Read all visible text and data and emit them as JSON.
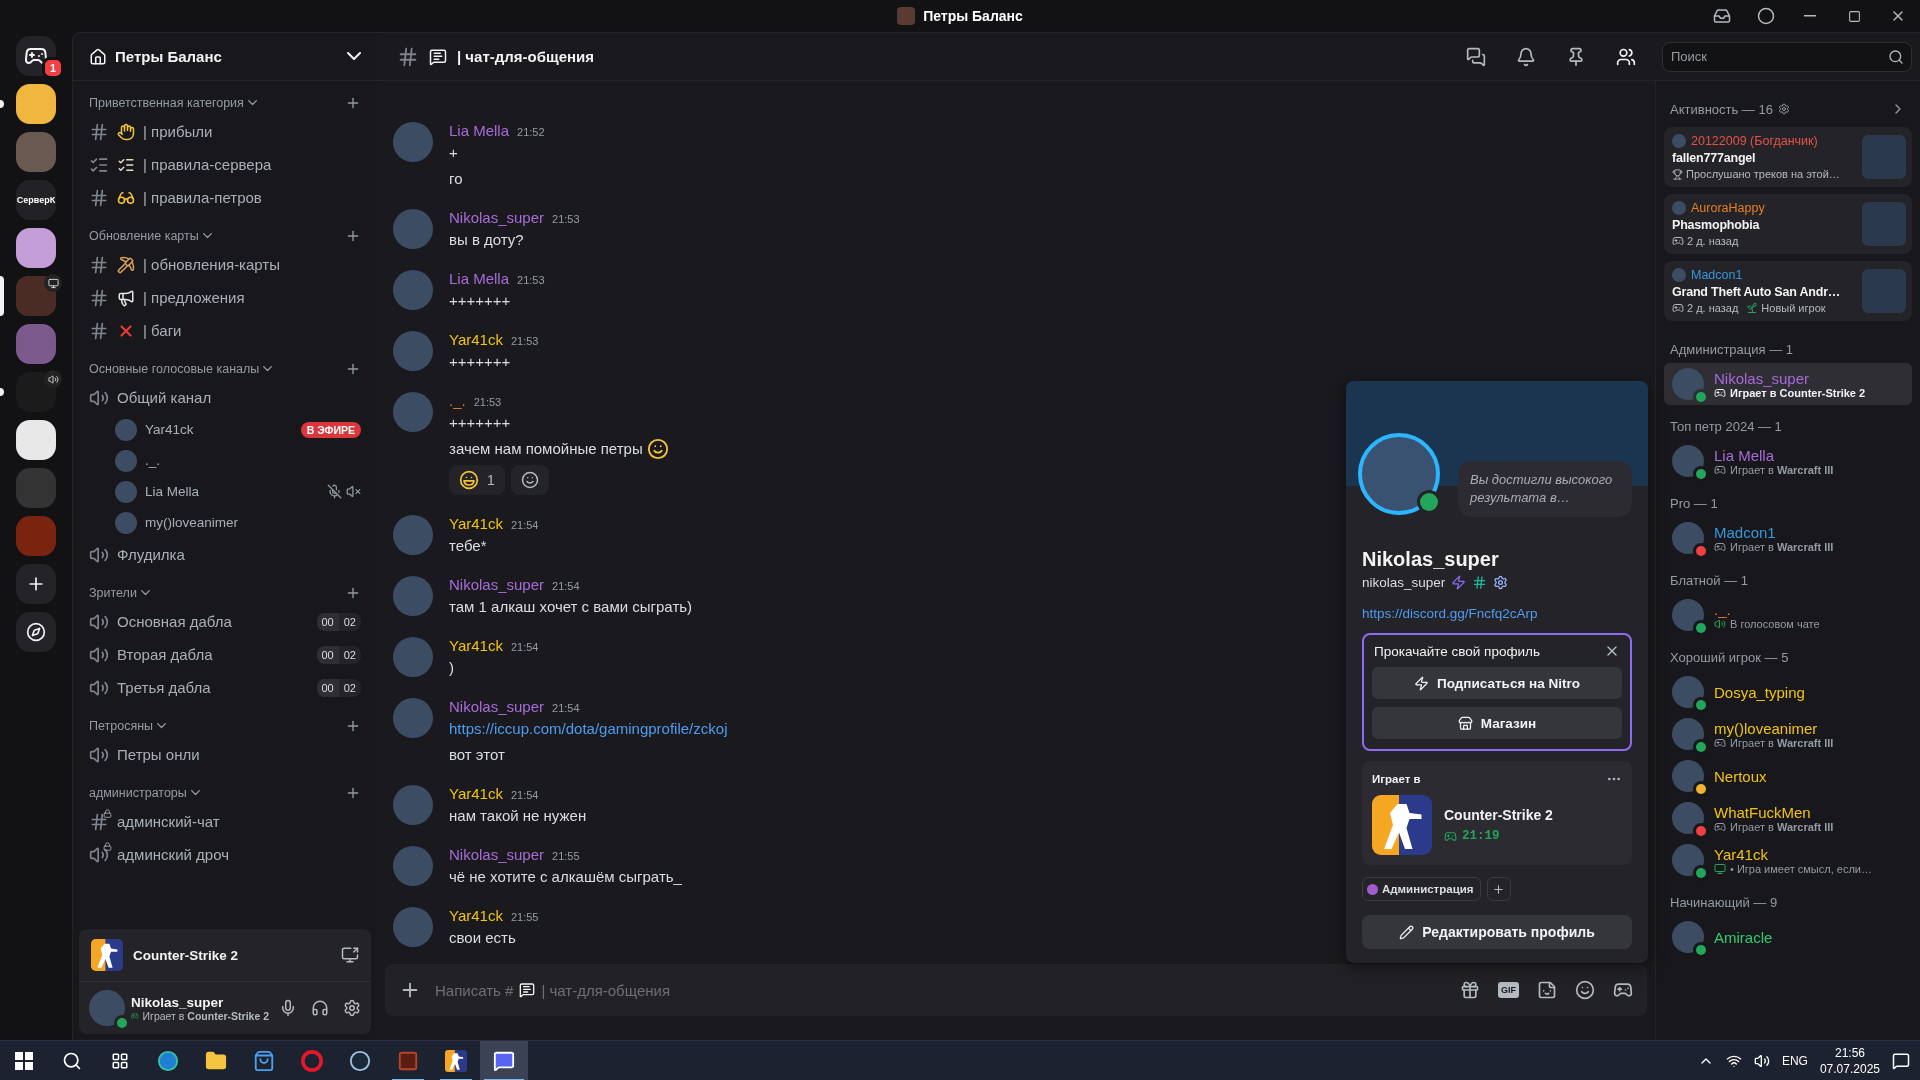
{
  "window": {
    "title": "Петры Баланс"
  },
  "servers": [
    {
      "kind": "home",
      "badge": "1",
      "selected": false,
      "unread": false
    },
    {
      "kind": "image",
      "selected": false,
      "unread": true
    },
    {
      "kind": "image",
      "selected": false,
      "unread": false
    },
    {
      "kind": "text",
      "label": "СерверК",
      "selected": false,
      "unread": false
    },
    {
      "kind": "image",
      "selected": false,
      "unread": false
    },
    {
      "kind": "image",
      "overlay": {
        "kind": "screen"
      },
      "selected": true,
      "unread": false
    },
    {
      "kind": "image",
      "selected": false,
      "unread": false
    },
    {
      "kind": "image",
      "overlay": {
        "kind": "voice"
      },
      "selected": false,
      "unread": true
    },
    {
      "kind": "image",
      "selected": false,
      "unread": false
    },
    {
      "kind": "image",
      "selected": false,
      "unread": false
    },
    {
      "kind": "image",
      "selected": false,
      "unread": false
    }
  ],
  "rail_actions": [
    {
      "kind": "add"
    },
    {
      "kind": "discover"
    }
  ],
  "server_header": {
    "name": "Петры Баланс"
  },
  "categories": [
    {
      "name": "Приветственная категория",
      "channels": [
        {
          "kind": "text",
          "emoji": {
            "kind": "wave"
          },
          "name": "| прибыли"
        },
        {
          "kind": "rules",
          "emoji": {
            "kind": "clipboard"
          },
          "name": "| правила-сервера"
        },
        {
          "kind": "text",
          "emoji": {
            "kind": "sunglasses"
          },
          "name": "| правила-петров"
        }
      ]
    },
    {
      "name": "Обновление карты",
      "channels": [
        {
          "kind": "text",
          "emoji": {
            "kind": "pick"
          },
          "name": "| обновления-карты"
        },
        {
          "kind": "text",
          "emoji": {
            "kind": "megaphone"
          },
          "name": "| предложения"
        },
        {
          "kind": "text",
          "emoji": {
            "kind": "cross"
          },
          "name": "| баги"
        }
      ]
    },
    {
      "name": "Основные голосовые каналы",
      "channels": [
        {
          "kind": "voice",
          "name": "Общий канал",
          "users": [
            {
              "name": "Yar41ck",
              "live": true,
              "live_label": "В ЭФИРЕ",
              "muted": false,
              "deafened": false
            },
            {
              "name": "._.",
              "live": false,
              "muted": false,
              "deafened": false
            },
            {
              "name": "Lia Mella",
              "live": false,
              "muted": true,
              "deafened": true
            },
            {
              "name": "my()loveanimer",
              "live": false,
              "muted": false,
              "deafened": false
            }
          ]
        },
        {
          "kind": "voice",
          "name": "Флудилка"
        }
      ]
    },
    {
      "name": "Зрители",
      "channels": [
        {
          "kind": "voice",
          "name": "Основная дабла",
          "count": "00",
          "limit": "02"
        },
        {
          "kind": "voice",
          "name": "Вторая дабла",
          "count": "00",
          "limit": "02"
        },
        {
          "kind": "voice",
          "name": "Третья дабла",
          "count": "00",
          "limit": "02"
        }
      ]
    },
    {
      "name": "Петросяны",
      "channels": [
        {
          "kind": "voice",
          "name": "Петры онли"
        }
      ]
    },
    {
      "name": "администраторы",
      "channels": [
        {
          "kind": "locked-text",
          "name": "админский-чат"
        },
        {
          "kind": "locked-voice",
          "name": "админский дроч"
        }
      ]
    }
  ],
  "user_panel": {
    "activity": "Counter-Strike 2",
    "name": "Nikolas_super",
    "status": {
      "kind": "online"
    },
    "status_text": "Играет в **Counter-Strike 2**"
  },
  "chat": {
    "channel": {
      "emoji": {
        "kind": "speech"
      },
      "name": "| чат-для-общения"
    },
    "messages": [
      {
        "author": "Lia Mella",
        "color": "#a86bd9",
        "time": "21:52",
        "lines": [
          {
            "kind": "text",
            "text": "+"
          },
          {
            "kind": "text",
            "text": "го"
          }
        ]
      },
      {
        "author": "Nikolas_super",
        "color": "#a86bd9",
        "time": "21:53",
        "lines": [
          {
            "kind": "text",
            "text": "вы в доту?"
          }
        ]
      },
      {
        "author": "Lia Mella",
        "color": "#a86bd9",
        "time": "21:53",
        "lines": [
          {
            "kind": "text",
            "text": "+++++++"
          }
        ]
      },
      {
        "author": "Yar41ck",
        "color": "#f1c40f",
        "time": "21:53",
        "lines": [
          {
            "kind": "text",
            "text": "+++++++"
          }
        ]
      },
      {
        "author": "._.",
        "color": "#e67e22",
        "time": "21:53",
        "lines": [
          {
            "kind": "text",
            "text": "+++++++"
          },
          {
            "kind": "text",
            "text": "зачем нам помойные петры",
            "emoji": {
              "kind": "smile"
            }
          }
        ],
        "reactions": [
          {
            "emoji": {
              "kind": "laugh"
            },
            "count": "1"
          }
        ]
      },
      {
        "author": "Yar41ck",
        "color": "#f1c40f",
        "time": "21:54",
        "lines": [
          {
            "kind": "text",
            "text": "тебе*"
          }
        ]
      },
      {
        "author": "Nikolas_super",
        "color": "#a86bd9",
        "time": "21:54",
        "lines": [
          {
            "kind": "text",
            "text": "там 1 алкаш хочет с вами сыграть)"
          }
        ]
      },
      {
        "author": "Yar41ck",
        "color": "#f1c40f",
        "time": "21:54",
        "lines": [
          {
            "kind": "text",
            "text": ")"
          }
        ]
      },
      {
        "author": "Nikolas_super",
        "color": "#a86bd9",
        "time": "21:54",
        "lines": [
          {
            "kind": "link",
            "text": "https://iccup.com/dota/gamingprofile/zckoj"
          },
          {
            "kind": "text",
            "text": "вот этот"
          }
        ]
      },
      {
        "author": "Yar41ck",
        "color": "#f1c40f",
        "time": "21:54",
        "lines": [
          {
            "kind": "text",
            "text": "нам такой не нужен"
          }
        ]
      },
      {
        "author": "Nikolas_super",
        "color": "#a86bd9",
        "time": "21:55",
        "lines": [
          {
            "kind": "text",
            "text": "чё не хотите с алкашём сыграть_"
          }
        ]
      },
      {
        "author": "Yar41ck",
        "color": "#f1c40f",
        "time": "21:55",
        "lines": [
          {
            "kind": "text",
            "text": "свои есть"
          }
        ]
      }
    ],
    "composer": {
      "placeholder": "Написать #",
      "channel": "| чат-для-общения",
      "gif_label": "GIF"
    }
  },
  "search": {
    "placeholder": "Поиск"
  },
  "profile": {
    "note": "Вы достигли высокого результата в…",
    "display_name": "Nikolas_super",
    "username": "nikolas_super",
    "status": {
      "kind": "online"
    },
    "link": "https://discord.gg/Fncfq2cArp",
    "promo": {
      "title": "Прокачайте свой профиль",
      "buttons": [
        {
          "kind": "nitro",
          "label": "Подписаться на Nitro"
        },
        {
          "kind": "shop",
          "label": "Магазин"
        }
      ]
    },
    "activity": {
      "heading": "Играет в",
      "game": "Counter-Strike 2",
      "elapsed": "21:19"
    },
    "roles": [
      {
        "name": "Администрация",
        "color": "#a25ad0"
      }
    ],
    "edit_label": "Редактировать профиль"
  },
  "activity_feed": {
    "title": "Активность — 16",
    "cards": [
      {
        "user": "20122009 (Богданчик)",
        "color": "#e2544b",
        "title": "fallen777angel",
        "details": [
          {
            "kind": "trophy",
            "text": "Прослушано треков на этой…"
          }
        ]
      },
      {
        "user": "AuroraHappy",
        "color": "#e67e22",
        "title": "Phasmophobia",
        "details": [
          {
            "kind": "game",
            "text": "2 д. назад"
          }
        ]
      },
      {
        "user": "Madcon1",
        "color": "#3498db",
        "title": "Grand Theft Auto San Andr…",
        "details": [
          {
            "kind": "game",
            "text": "2 д. назад"
          },
          {
            "kind": "sprout",
            "text": "Новый игрок"
          }
        ]
      }
    ]
  },
  "member_groups": [
    {
      "title": "Администрация — 1",
      "members": [
        {
          "name": "Nikolas_super",
          "color": "#a86bd9",
          "status": {
            "kind": "online"
          },
          "selected": true,
          "activity": {
            "kind": "game",
            "text": "Играет в **Counter-Strike 2**"
          }
        }
      ]
    },
    {
      "title": "Топ петр 2024 — 1",
      "members": [
        {
          "name": "Lia Mella",
          "color": "#a86bd9",
          "status": {
            "kind": "online"
          },
          "selected": false,
          "activity": {
            "kind": "game",
            "text": "Играет в **Warcraft III**"
          }
        }
      ]
    },
    {
      "title": "Pro — 1",
      "members": [
        {
          "name": "Madcon1",
          "color": "#3498db",
          "status": {
            "kind": "dnd"
          },
          "selected": false,
          "activity": {
            "kind": "game",
            "text": "Играет в **Warcraft III**"
          }
        }
      ]
    },
    {
      "title": "Блатной — 1",
      "members": [
        {
          "name": "._.",
          "color": "#e67e22",
          "status": {
            "kind": "online"
          },
          "selected": false,
          "activity": {
            "kind": "voice",
            "text": "В голосовом чате"
          }
        }
      ]
    },
    {
      "title": "Хороший игрок — 5",
      "members": [
        {
          "name": "Dosya_typing",
          "color": "#f1c40f",
          "status": {
            "kind": "online"
          },
          "selected": false
        },
        {
          "name": "my()loveanimer",
          "color": "#f1c40f",
          "status": {
            "kind": "online"
          },
          "selected": false,
          "activity": {
            "kind": "game",
            "text": "Играет в **Warcraft III**"
          }
        },
        {
          "name": "Nertoux",
          "color": "#f1c40f",
          "status": {
            "kind": "idle"
          },
          "selected": false
        },
        {
          "name": "WhatFuckMen",
          "color": "#f1c40f",
          "status": {
            "kind": "dnd"
          },
          "selected": false,
          "activity": {
            "kind": "game",
            "text": "Играет в **Warcraft III**"
          }
        },
        {
          "name": "Yar41ck",
          "color": "#f1c40f",
          "status": {
            "kind": "online"
          },
          "selected": false,
          "activity": {
            "kind": "custom",
            "text": "• Игра имеет смысл, если…"
          }
        }
      ]
    },
    {
      "title": "Начинающий — 9",
      "members": [
        {
          "name": "Amiracle",
          "color": "#2ecc71",
          "status": {
            "kind": "online"
          },
          "selected": false
        }
      ]
    }
  ],
  "taskbar": {
    "apps": [
      {
        "kind": "browser",
        "running": false,
        "selected": false
      },
      {
        "kind": "folder",
        "running": false,
        "selected": false
      },
      {
        "kind": "store",
        "running": false,
        "selected": false
      },
      {
        "kind": "ring",
        "running": false,
        "selected": false
      },
      {
        "kind": "steam",
        "running": false,
        "selected": false
      },
      {
        "kind": "game",
        "running": true,
        "selected": false
      },
      {
        "kind": "cs",
        "running": true,
        "selected": false
      },
      {
        "kind": "chat",
        "running": true,
        "selected": true
      }
    ],
    "language": "ENG",
    "time": "21:56",
    "date": "07.07.2025"
  }
}
